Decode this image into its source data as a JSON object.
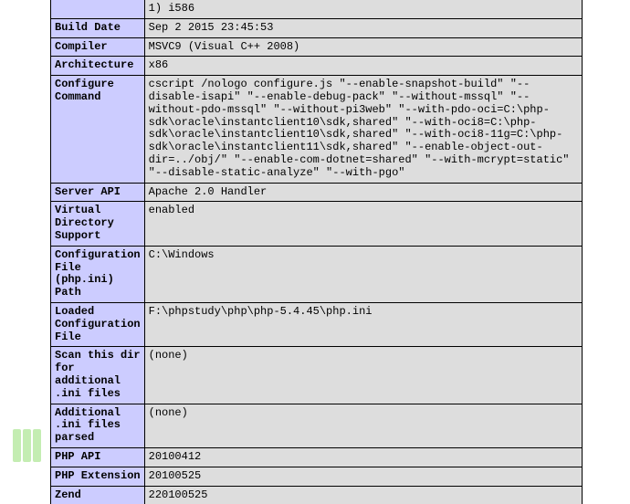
{
  "rows": [
    {
      "label": "",
      "value": "1) i586",
      "partial_top": true
    },
    {
      "label": "Build Date",
      "value": "Sep 2 2015 23:45:53"
    },
    {
      "label": "Compiler",
      "value": "MSVC9 (Visual C++ 2008)"
    },
    {
      "label": "Architecture",
      "value": "x86"
    },
    {
      "label": "Configure Command",
      "value": "cscript /nologo configure.js \"--enable-snapshot-build\" \"--disable-isapi\" \"--enable-debug-pack\" \"--without-mssql\" \"--without-pdo-mssql\" \"--without-pi3web\" \"--with-pdo-oci=C:\\php-sdk\\oracle\\instantclient10\\sdk,shared\" \"--with-oci8=C:\\php-sdk\\oracle\\instantclient10\\sdk,shared\" \"--with-oci8-11g=C:\\php-sdk\\oracle\\instantclient11\\sdk,shared\" \"--enable-object-out-dir=../obj/\" \"--enable-com-dotnet=shared\" \"--with-mcrypt=static\" \"--disable-static-analyze\" \"--with-pgo\""
    },
    {
      "label": "Server API",
      "value": "Apache 2.0 Handler"
    },
    {
      "label": "Virtual Directory Support",
      "value": "enabled"
    },
    {
      "label": "Configuration File (php.ini) Path",
      "value": "C:\\Windows"
    },
    {
      "label": "Loaded Configuration File",
      "value": "F:\\phpstudy\\php\\php-5.4.45\\php.ini"
    },
    {
      "label": "Scan this dir for additional .ini files",
      "value": "(none)"
    },
    {
      "label": "Additional .ini files parsed",
      "value": "(none)"
    },
    {
      "label": "PHP API",
      "value": "20100412"
    },
    {
      "label": "PHP Extension",
      "value": "20100525"
    },
    {
      "label": "Zend",
      "value": "220100525",
      "partial_bottom": true
    }
  ]
}
